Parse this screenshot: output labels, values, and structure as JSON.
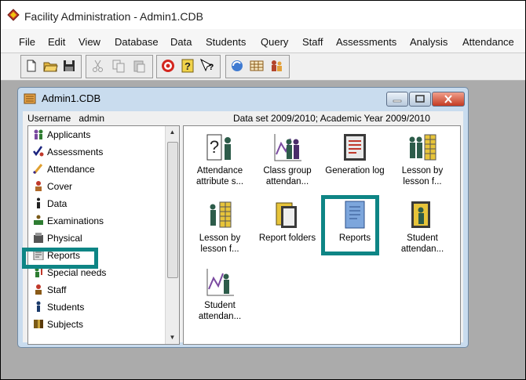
{
  "app": {
    "title": "Facility Administration - Admin1.CDB"
  },
  "menubar": {
    "items": [
      "File",
      "Edit",
      "View",
      "Database",
      "Data",
      "Students",
      "Query",
      "Staff",
      "Assessments",
      "Analysis",
      "Attendance"
    ]
  },
  "toolbar": {
    "buttons": [
      "new-icon",
      "open-icon",
      "save-icon",
      "cut-icon",
      "copy-icon",
      "paste-icon",
      "target-icon",
      "help-icon",
      "whats-this-icon",
      "refresh-icon",
      "grid-icon",
      "users-icon"
    ]
  },
  "child_window": {
    "title": "Admin1.CDB",
    "username_label": "Username",
    "username_value": "admin",
    "dataset_text": "Data set  2009/2010; Academic Year 2009/2010"
  },
  "nav": {
    "items": [
      {
        "label": "Applicants",
        "icon": "applicants-icon"
      },
      {
        "label": "Assessments",
        "icon": "assessments-icon"
      },
      {
        "label": "Attendance",
        "icon": "attendance-icon"
      },
      {
        "label": "Cover",
        "icon": "cover-icon"
      },
      {
        "label": "Data",
        "icon": "data-icon"
      },
      {
        "label": "Examinations",
        "icon": "examinations-icon"
      },
      {
        "label": "Physical",
        "icon": "physical-icon"
      },
      {
        "label": "Reports",
        "icon": "reports-icon"
      },
      {
        "label": "Special needs",
        "icon": "special-needs-icon"
      },
      {
        "label": "Staff",
        "icon": "staff-icon"
      },
      {
        "label": "Students",
        "icon": "students-icon"
      },
      {
        "label": "Subjects",
        "icon": "subjects-icon"
      }
    ],
    "highlighted": "Reports"
  },
  "tiles": [
    {
      "line1": "Attendance",
      "line2": "attribute s...",
      "icon": "question-person-icon"
    },
    {
      "line1": "Class group",
      "line2": "attendan...",
      "icon": "chart-people-icon"
    },
    {
      "line1": "Generation log",
      "line2": "",
      "icon": "log-book-icon"
    },
    {
      "line1": "Lesson by",
      "line2": "lesson f...",
      "icon": "people-grid-icon"
    },
    {
      "line1": "Lesson by",
      "line2": "lesson f...",
      "icon": "person-grid-icon"
    },
    {
      "line1": "Report folders",
      "line2": "",
      "icon": "report-folders-icon"
    },
    {
      "line1": "Reports",
      "line2": "",
      "icon": "reports-doc-icon",
      "selected": true
    },
    {
      "line1": "Student",
      "line2": "attendan...",
      "icon": "student-register-icon"
    },
    {
      "line1": "Student",
      "line2": "attendan...",
      "icon": "student-chart-icon"
    }
  ],
  "colors": {
    "highlight": "#0e8585",
    "selection": "#3c6fb4"
  }
}
